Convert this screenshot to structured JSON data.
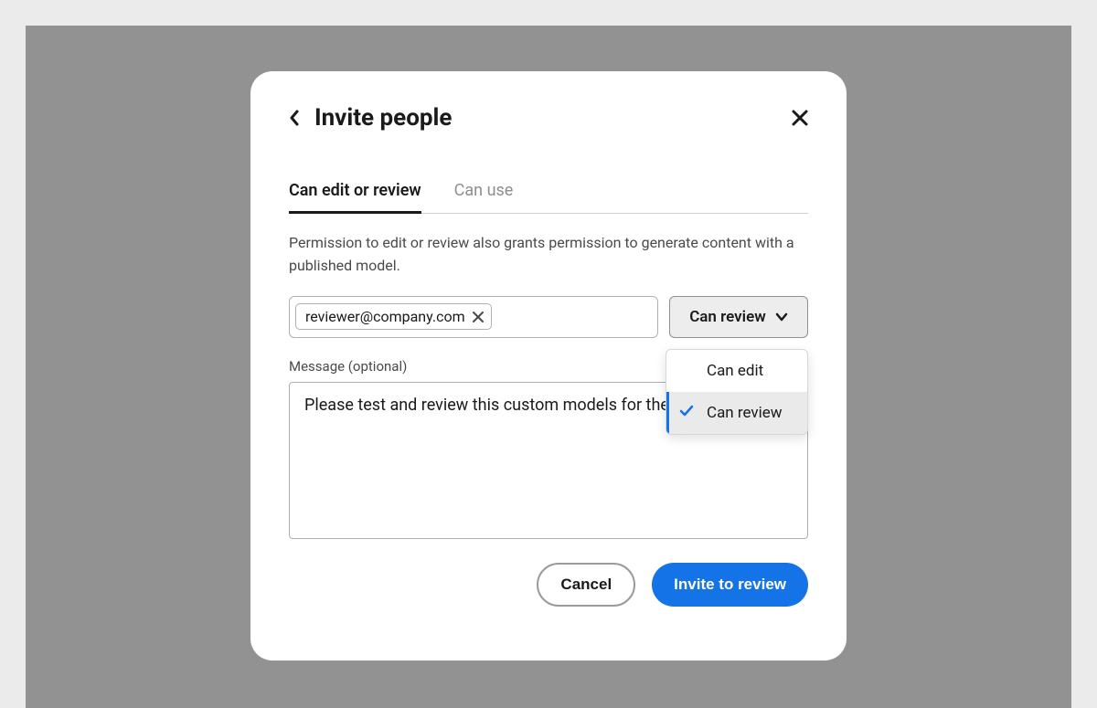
{
  "modal": {
    "title": "Invite people",
    "tabs": {
      "edit_review": "Can edit or review",
      "can_use": "Can use"
    },
    "description": "Permission to edit or review also grants permission to generate content with a published model.",
    "email_chip": "reviewer@company.com",
    "role_selected": "Can review",
    "dropdown": {
      "can_edit": "Can edit",
      "can_review": "Can review"
    },
    "message_label": "Message (optional)",
    "message_value": "Please test and review this custom models for the team.",
    "buttons": {
      "cancel": "Cancel",
      "invite": "Invite to review"
    }
  }
}
